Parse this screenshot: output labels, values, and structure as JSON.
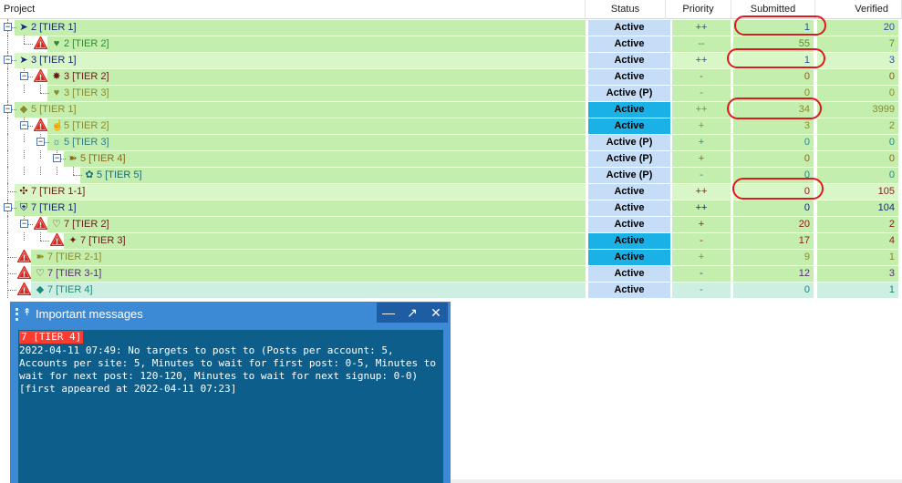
{
  "columns": {
    "project": "Project",
    "status": "Status",
    "priority": "Priority",
    "submitted": "Submitted",
    "verified": "Verified"
  },
  "rows": [
    {
      "label": "2 [TIER 1]",
      "glyph": "➤",
      "status": "Active",
      "priority": "++",
      "submitted": "1",
      "verified": "20"
    },
    {
      "label": "2 [TIER 2]",
      "glyph": "♥",
      "status": "Active",
      "priority": "--",
      "submitted": "55",
      "verified": "7"
    },
    {
      "label": "3 [TIER 1]",
      "glyph": "➤",
      "status": "Active",
      "priority": "++",
      "submitted": "1",
      "verified": "3"
    },
    {
      "label": "3 [TIER 2]",
      "glyph": "✸",
      "status": "Active",
      "priority": "-",
      "submitted": "0",
      "verified": "0"
    },
    {
      "label": "3 [TIER 3]",
      "glyph": "♥",
      "status": "Active (P)",
      "priority": "-",
      "submitted": "0",
      "verified": "0"
    },
    {
      "label": "5 [TIER 1]",
      "glyph": "◆",
      "status": "Active",
      "priority": "++",
      "submitted": "34",
      "verified": "3999"
    },
    {
      "label": "5 [TIER 2]",
      "glyph": "☝",
      "status": "Active",
      "priority": "+",
      "submitted": "3",
      "verified": "2"
    },
    {
      "label": "5 [TIER 3]",
      "glyph": "☼",
      "status": "Active (P)",
      "priority": "+",
      "submitted": "0",
      "verified": "0"
    },
    {
      "label": "5 [TIER 4]",
      "glyph": "➽",
      "status": "Active (P)",
      "priority": "+",
      "submitted": "0",
      "verified": "0"
    },
    {
      "label": "5 [TIER 5]",
      "glyph": "✿",
      "status": "Active (P)",
      "priority": "-",
      "submitted": "0",
      "verified": "0"
    },
    {
      "label": "7 [TIER 1-1]",
      "glyph": "✣",
      "status": "Active",
      "priority": "++",
      "submitted": "0",
      "verified": "105"
    },
    {
      "label": "7 [TIER 1]",
      "glyph": "⛨",
      "status": "Active",
      "priority": "++",
      "submitted": "0",
      "verified": "104"
    },
    {
      "label": "7 [TIER 2]",
      "glyph": "♡",
      "status": "Active",
      "priority": "+",
      "submitted": "20",
      "verified": "2"
    },
    {
      "label": "7 [TIER 3]",
      "glyph": "✦",
      "status": "Active",
      "priority": "-",
      "submitted": "17",
      "verified": "4"
    },
    {
      "label": "7 [TIER 2-1]",
      "glyph": "➽",
      "status": "Active",
      "priority": "+",
      "submitted": "9",
      "verified": "1"
    },
    {
      "label": "7 [TIER 3-1]",
      "glyph": "♡",
      "status": "Active",
      "priority": "-",
      "submitted": "12",
      "verified": "3"
    },
    {
      "label": "7 [TIER 4]",
      "glyph": "◆",
      "status": "Active",
      "priority": "-",
      "submitted": "0",
      "verified": "1"
    }
  ],
  "panel": {
    "title": "Important messages",
    "pin_glyph": "↟",
    "minimize_glyph": "—",
    "float_glyph": "↗",
    "close_glyph": "✕",
    "message_project": "7 [TIER 4]",
    "message_text": "2022-04-11 07:49: No targets to post to (Posts per account: 5, Accounts per site: 5, Minutes to wait for first post: 0-5, Minutes to wait for next post: 120-120, Minutes to wait for next signup: 0-0) [first appeared at 2022-04-11 07:23]"
  },
  "colors": {
    "row_light_green": "#c3eeae",
    "row_lighter_green": "#d9f7c6",
    "row_mint": "#cdeee0",
    "status_active": "#c5ddf7",
    "status_active_hot": "#1ab1e6",
    "annotation_red": "#e0191e",
    "panel_blue": "#3c8ad6",
    "message_bg": "#0e5e8c",
    "warning_red": "#d9261c"
  }
}
